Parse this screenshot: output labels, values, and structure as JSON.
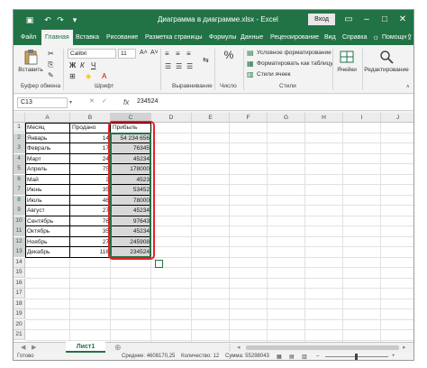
{
  "titlebar": {
    "title": "Диаграмма в диаграмме.xlsx - Excel",
    "login": "Вход"
  },
  "tabs": [
    "Файл",
    "Главная",
    "Вставка",
    "Рисование",
    "Разметка страницы",
    "Формулы",
    "Данные",
    "Рецензирование",
    "Вид",
    "Справка",
    "Помощн"
  ],
  "ribbon": {
    "paste": "Вставить",
    "font_name": "Calibri",
    "font_size": "11",
    "cond_format": "Условное форматирование",
    "format_table": "Форматировать как таблицу",
    "cell_styles": "Стили ячеек",
    "cells": "Ячейки",
    "editing": "Редактирование",
    "groups": {
      "clipboard": "Буфер обмена",
      "font": "Шрифт",
      "alignment": "Выравнивание",
      "number": "Число",
      "styles": "Стили"
    }
  },
  "formula_bar": {
    "name_box": "C13",
    "fx": "fx",
    "value": "234524"
  },
  "grid": {
    "columns": [
      "A",
      "B",
      "C",
      "D",
      "E",
      "F",
      "G",
      "H",
      "I",
      "J"
    ],
    "rows": [
      "1",
      "2",
      "3",
      "4",
      "5",
      "6",
      "7",
      "8",
      "9",
      "10",
      "11",
      "12",
      "13",
      "14",
      "15",
      "16",
      "17",
      "18",
      "19",
      "20",
      "21"
    ],
    "headers": [
      "Месяц",
      "Продано",
      "Прибыль"
    ],
    "data": [
      [
        "Январь",
        "14",
        "54 234 656"
      ],
      [
        "Февраль",
        "17",
        "76345"
      ],
      [
        "Март",
        "24",
        "45234"
      ],
      [
        "Апрель",
        "75",
        "178000"
      ],
      [
        "Май",
        "3",
        "4523"
      ],
      [
        "Июнь",
        "35",
        "53452"
      ],
      [
        "Июль",
        "46",
        "78000"
      ],
      [
        "Август",
        "27",
        "45234"
      ],
      [
        "Сентябрь",
        "76",
        "97643"
      ],
      [
        "Октябрь",
        "35",
        "45234"
      ],
      [
        "Ноябрь",
        "27",
        "245908"
      ],
      [
        "Декабрь",
        "116",
        "234524"
      ]
    ]
  },
  "sheet": {
    "name": "Лист1"
  },
  "status": {
    "ready": "Готово",
    "average": "Среднее: 4608170,25",
    "count": "Количество: 12",
    "sum": "Сумма: 55298043"
  }
}
